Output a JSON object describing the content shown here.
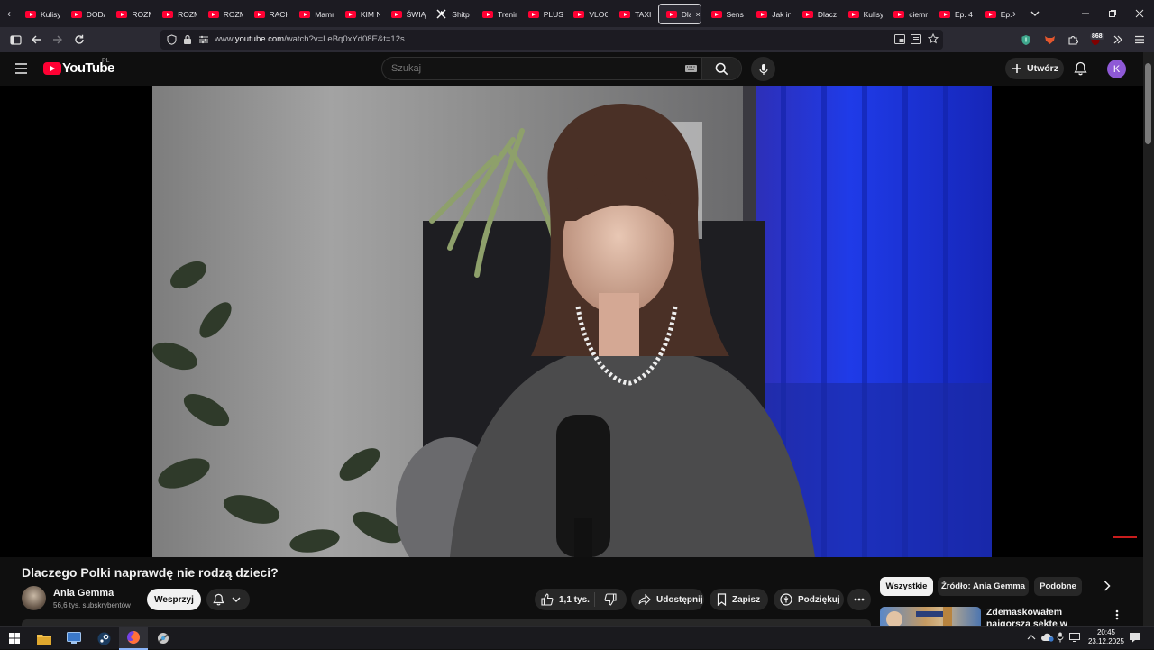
{
  "browser": {
    "tabs": [
      {
        "label": "Kulisy",
        "favicon": "youtube-icon"
      },
      {
        "label": "DODA",
        "favicon": "youtube-icon"
      },
      {
        "label": "ROZM",
        "favicon": "youtube-icon"
      },
      {
        "label": "ROZM",
        "favicon": "youtube-icon"
      },
      {
        "label": "ROZM",
        "favicon": "youtube-icon"
      },
      {
        "label": "RACH",
        "favicon": "youtube-icon"
      },
      {
        "label": "Mamr",
        "favicon": "youtube-icon"
      },
      {
        "label": "KIM N",
        "favicon": "youtube-icon"
      },
      {
        "label": "ŚWIĄ",
        "favicon": "youtube-icon"
      },
      {
        "label": "Shitp",
        "favicon": "x-icon"
      },
      {
        "label": "Trenin",
        "favicon": "youtube-icon"
      },
      {
        "label": "PLUSK",
        "favicon": "youtube-icon"
      },
      {
        "label": "VLOG",
        "favicon": "youtube-icon"
      },
      {
        "label": "TAXI E",
        "favicon": "youtube-icon"
      },
      {
        "label": "Dla",
        "favicon": "youtube-icon",
        "active": true
      },
      {
        "label": "Sens p",
        "favicon": "youtube-icon"
      },
      {
        "label": "Jak int",
        "favicon": "youtube-icon"
      },
      {
        "label": "Dlacz",
        "favicon": "youtube-icon"
      },
      {
        "label": "Kulisy",
        "favicon": "youtube-icon"
      },
      {
        "label": "ciemn",
        "favicon": "youtube-icon"
      },
      {
        "label": "Ep. 4",
        "favicon": "youtube-icon"
      },
      {
        "label": "Ep.",
        "favicon": "youtube-icon"
      }
    ],
    "tab_close_glyph": "×",
    "url_prefix": "www.",
    "url_host": "youtube.com",
    "url_path": "/watch?v=LeBq0xYd08E&t=12s",
    "extension_badge": "868"
  },
  "youtube": {
    "logo_text": "YouTube",
    "country_code": "PL",
    "search_placeholder": "Szukaj",
    "create_label": "Utwórz",
    "avatar_letter": "K",
    "brand_color": "#ff0033"
  },
  "video": {
    "title": "Dlaczego Polki naprawdę nie rodzą dzieci?",
    "channel_name": "Ania Gemma",
    "subscribers": "56,6 tys. subskrybentów",
    "support_label": "Wesprzyj",
    "like_count": "1,1 tys.",
    "share_label": "Udostępnij",
    "save_label": "Zapisz",
    "thanks_label": "Podziękuj"
  },
  "sidebar": {
    "chips": [
      "Wszystkie",
      "Źródło: Ania Gemma",
      "Podobne"
    ],
    "recommendation_title": "Zdemaskowałem najgorszą sektę w Ameryce"
  },
  "taskbar": {
    "time": "20:45",
    "date": "23.12.2025",
    "apps": [
      "windows-start-icon",
      "file-explorer-icon",
      "remote-desktop-icon",
      "steam-icon",
      "firefox-icon",
      "other-app-icon"
    ]
  }
}
